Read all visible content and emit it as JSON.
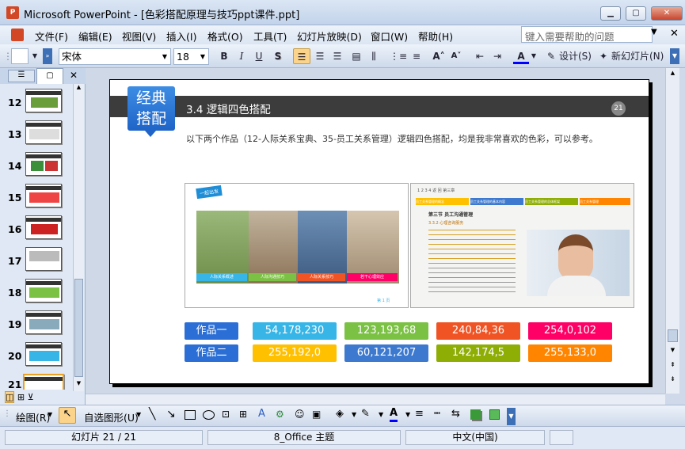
{
  "window": {
    "title": "Microsoft PowerPoint - [色彩搭配原理与技巧ppt课件.ppt]",
    "app_icon": "P"
  },
  "menu": [
    "文件(F)",
    "编辑(E)",
    "视图(V)",
    "插入(I)",
    "格式(O)",
    "工具(T)",
    "幻灯片放映(D)",
    "窗口(W)",
    "帮助(H)"
  ],
  "help_placeholder": "键入需要帮助的问题",
  "toolbar": {
    "font": "宋体",
    "size": "18",
    "bold": "B",
    "italic": "I",
    "underline": "U",
    "shadow": "S",
    "design": "设计(S)",
    "new_slide": "新幻灯片(N)"
  },
  "slides": [
    {
      "num": "12"
    },
    {
      "num": "13"
    },
    {
      "num": "14"
    },
    {
      "num": "15"
    },
    {
      "num": "16"
    },
    {
      "num": "17"
    },
    {
      "num": "18"
    },
    {
      "num": "19"
    },
    {
      "num": "20"
    },
    {
      "num": "21"
    }
  ],
  "slide": {
    "badge_line1": "经典",
    "badge_line2": "搭配",
    "title": "3.4 逻辑四色搭配",
    "page_number": "21",
    "body": "以下两个作品（12-人际关系宝典、35-员工关系管理）逻辑四色搭配，均是我非常喜欢的色彩，可以参考。",
    "left_image": {
      "logo": "一起出发",
      "captions": [
        "人际关系概述",
        "人际沟通技巧",
        "人际关系技巧",
        "若干心理效应"
      ],
      "page": "第 1 页"
    },
    "right_image": {
      "nav": "1 2 3 4 返 回 第三章",
      "tabs": [
        "员工关系管理的概念",
        "员工关系管理的基本内容",
        "员工关系管理的总体框架",
        "员工关系管理"
      ],
      "heading": "第三节  员工沟通管理",
      "subheading": "3.3.2 心理咨询服务"
    },
    "rows": [
      {
        "label": "作品一",
        "values": [
          "54,178,230",
          "123,193,68",
          "240,84,36",
          "254,0,102"
        ]
      },
      {
        "label": "作品二",
        "values": [
          "255,192,0",
          "60,121,207",
          "142,174,5",
          "255,133,0"
        ]
      }
    ]
  },
  "drawbar": {
    "draw": "绘图(R)",
    "autoshape": "自选图形(U)"
  },
  "status": {
    "slide": "幻灯片 21 / 21",
    "theme": "8_Office 主题",
    "language": "中文(中国)"
  },
  "colors": {
    "row_label": "#2b6fd6",
    "cells": [
      "#36b5e6",
      "#7bc143",
      "#f05424",
      "#fe0066",
      "#ffc000",
      "#3c79cf",
      "#8eae05",
      "#ff8500"
    ]
  }
}
